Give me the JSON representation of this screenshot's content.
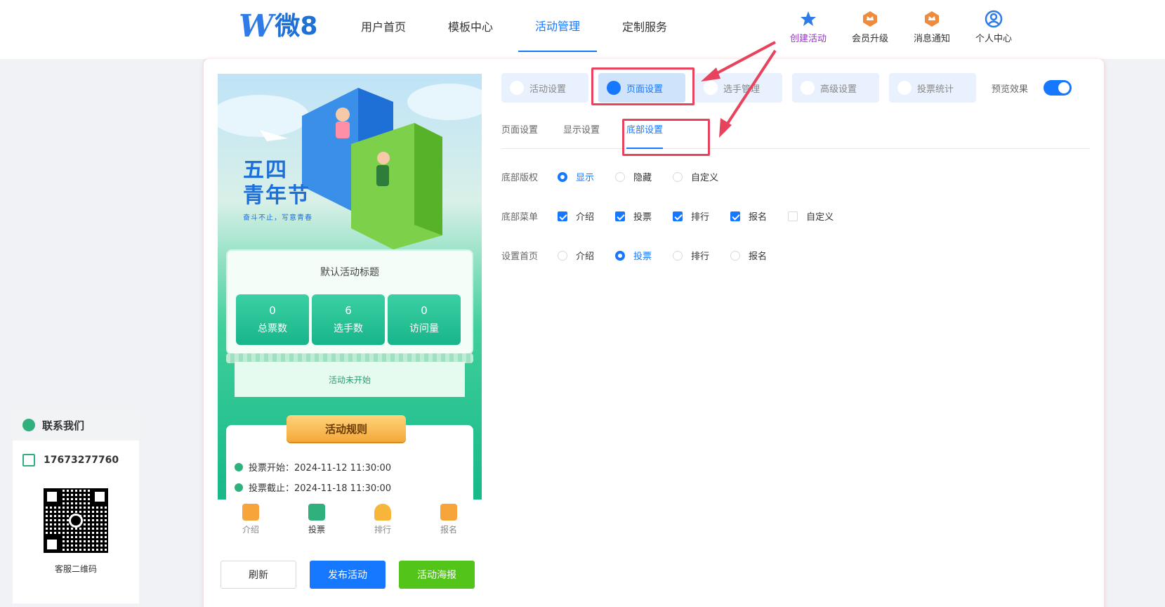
{
  "header": {
    "logo_mark": "W",
    "logo_text": "微8",
    "nav": [
      "用户首页",
      "模板中心",
      "活动管理",
      "定制服务"
    ],
    "actions": [
      {
        "label": "创建活动",
        "icon": "star-icon"
      },
      {
        "label": "会员升级",
        "icon": "crown-badge-icon"
      },
      {
        "label": "消息通知",
        "icon": "bell-badge-icon"
      },
      {
        "label": "个人中心",
        "icon": "user-icon"
      }
    ]
  },
  "preview": {
    "hero_title_1": "五四",
    "hero_title_2": "青年节",
    "hero_subtitle": "奋斗不止，写意青春",
    "stat_title": "默认活动标题",
    "stats": [
      {
        "value": "0",
        "label": "总票数"
      },
      {
        "value": "6",
        "label": "选手数"
      },
      {
        "value": "0",
        "label": "访问量"
      }
    ],
    "status": "活动未开始",
    "rules_title": "活动规则",
    "vote_start": "投票开始：2024-11-12 11:30:00",
    "vote_end": "投票截止：2024-11-18 11:30:00",
    "tabs": [
      "介绍",
      "投票",
      "排行",
      "报名"
    ]
  },
  "buttons": {
    "refresh": "刷新",
    "publish": "发布活动",
    "poster": "活动海报"
  },
  "tabs": [
    "活动设置",
    "页面设置",
    "选手管理",
    "高级设置",
    "投票统计"
  ],
  "preview_label": "预览效果",
  "subtabs": [
    "页面设置",
    "显示设置",
    "底部设置"
  ],
  "form": {
    "copyright": {
      "label": "底部版权",
      "options": [
        "显示",
        "隐藏",
        "自定义"
      ]
    },
    "menu": {
      "label": "底部菜单",
      "options": [
        "介绍",
        "投票",
        "排行",
        "报名",
        "自定义"
      ]
    },
    "home": {
      "label": "设置首页",
      "options": [
        "介绍",
        "投票",
        "排行",
        "报名"
      ]
    }
  },
  "contact": {
    "title": "联系我们",
    "phone": "17673277760",
    "qr_label": "客服二维码"
  },
  "colors": {
    "primary": "#1677ff",
    "success": "#52c41a",
    "highlight": "#e8435c"
  }
}
